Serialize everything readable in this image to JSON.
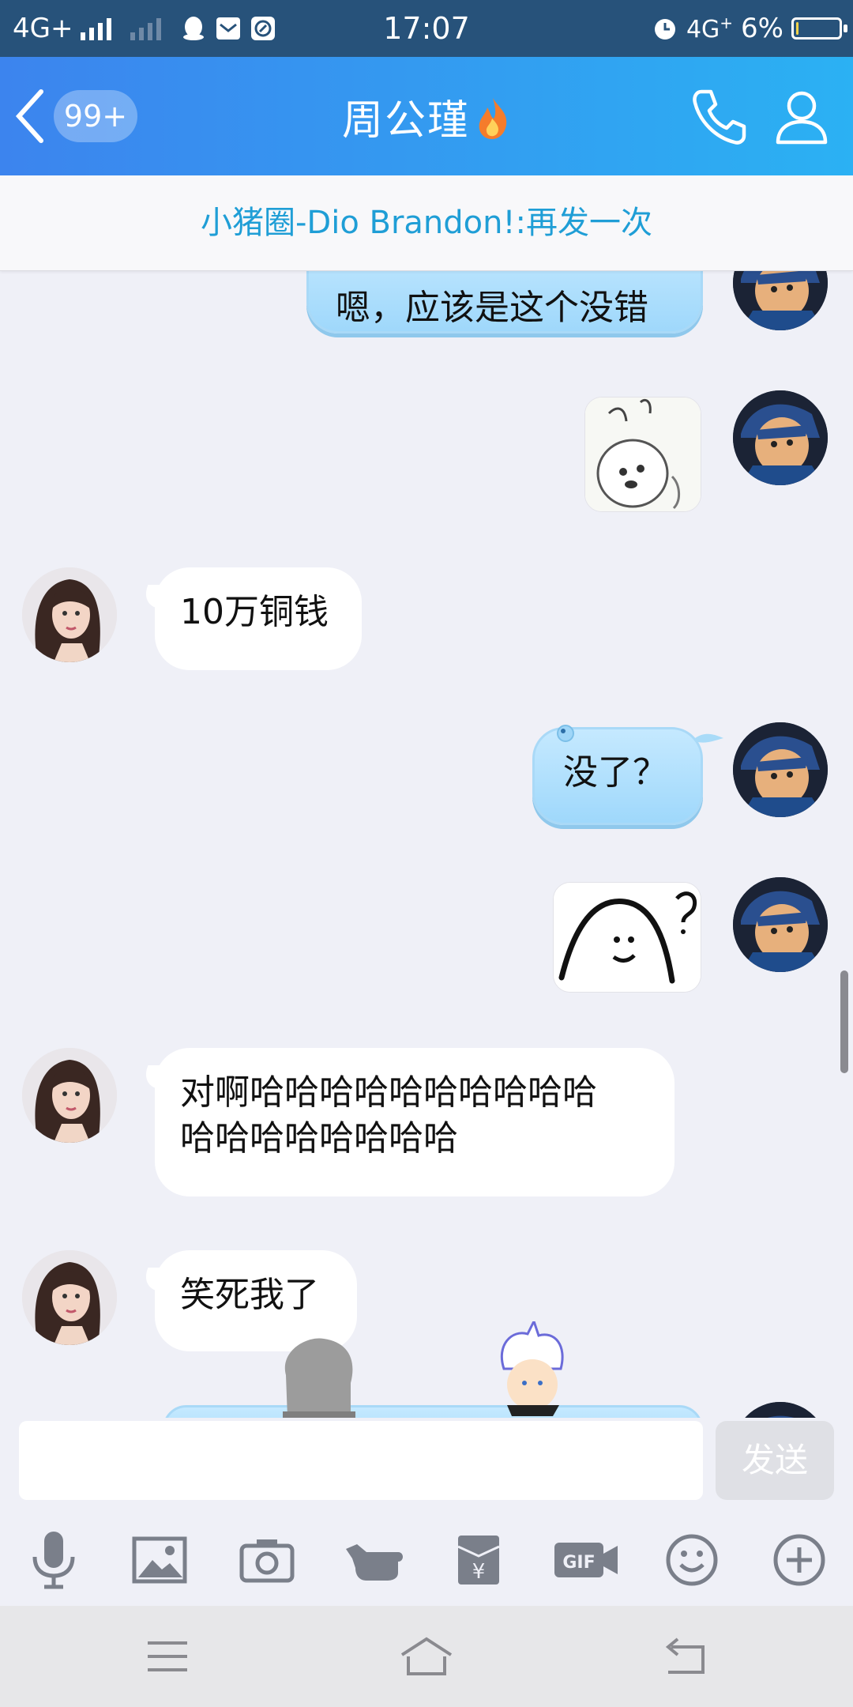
{
  "status_bar": {
    "network_1": "4G+",
    "time": "17:07",
    "network_2": "4G",
    "battery": "6%"
  },
  "header": {
    "unread_count": "99+",
    "contact_name": "周公瑾"
  },
  "notice": {
    "text": "小猪圈-Dio Brandon!:再发一次"
  },
  "messages": [
    {
      "side": "out",
      "type": "text",
      "text": "嗯，应该是这个没错"
    },
    {
      "side": "out",
      "type": "sticker",
      "icon": "bunny-sticker"
    },
    {
      "side": "in",
      "type": "text",
      "text": "10万铜钱"
    },
    {
      "side": "out",
      "type": "text",
      "text": "没了？"
    },
    {
      "side": "out",
      "type": "sticker",
      "icon": "question-blob-sticker"
    },
    {
      "side": "in",
      "type": "text",
      "line1": "对啊哈哈哈哈哈哈哈哈哈哈",
      "line2": "哈哈哈哈哈哈哈哈"
    },
    {
      "side": "in",
      "type": "text",
      "text": "笑死我了"
    }
  ],
  "composer": {
    "input_value": "",
    "send_label": "发送"
  },
  "toolbar_icons": [
    "microphone-icon",
    "image-icon",
    "camera-icon",
    "poke-icon",
    "red-packet-icon",
    "gif-icon",
    "emoji-icon",
    "plus-icon"
  ],
  "colors": {
    "header_start": "#3c84ee",
    "header_end": "#2bb1f3",
    "notice_text": "#1f9ed6",
    "chat_bg": "#eff0f7",
    "bubble_out": "#aee0fc"
  }
}
